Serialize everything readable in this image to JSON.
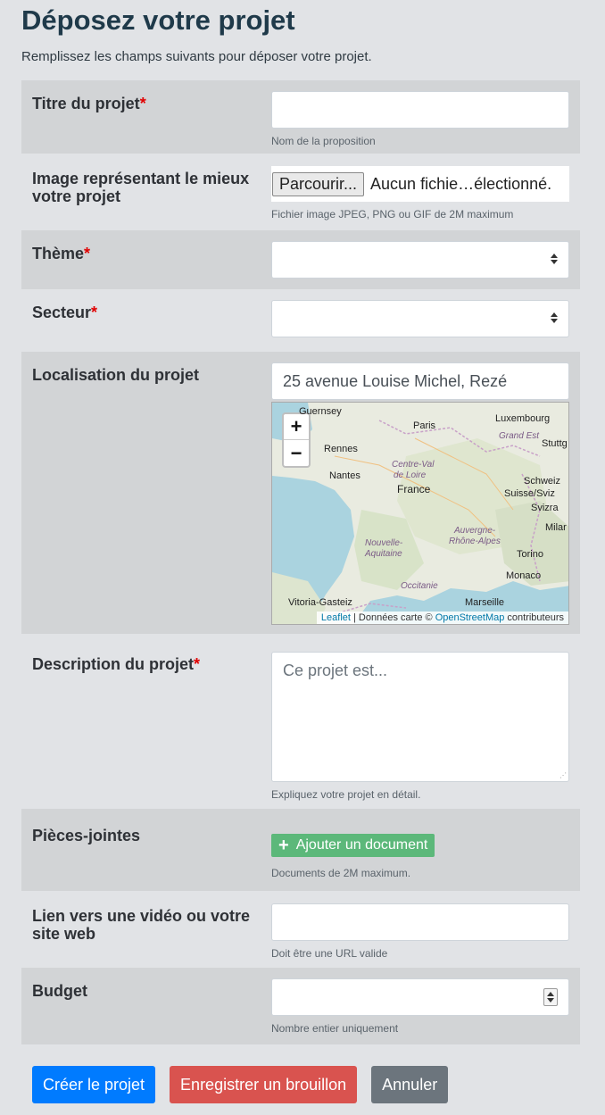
{
  "page": {
    "title": "Déposez votre projet",
    "intro": "Remplissez les champs suivants pour déposer votre projet."
  },
  "fields": {
    "titre": {
      "label": "Titre du projet",
      "required": "*",
      "value": "",
      "help": "Nom de la proposition"
    },
    "image": {
      "label": "Image représentant le mieux votre projet",
      "button": "Parcourir...",
      "status": "Aucun fichie…électionné.",
      "help": "Fichier image JPEG, PNG ou GIF de 2M maximum"
    },
    "theme": {
      "label": "Thème",
      "required": "*",
      "value": ""
    },
    "secteur": {
      "label": "Secteur",
      "required": "*",
      "value": ""
    },
    "localisation": {
      "label": "Localisation du projet",
      "value": "25 avenue Louise Michel, Rezé"
    },
    "description": {
      "label": "Description du projet",
      "required": "*",
      "placeholder": "Ce projet est...",
      "help": "Expliquez votre projet en détail."
    },
    "pieces": {
      "label": "Pièces-jointes",
      "button": "Ajouter un document",
      "help": "Documents de 2M maximum."
    },
    "lien": {
      "label": "Lien vers une vidéo ou votre site web",
      "value": "",
      "help": "Doit être une URL valide"
    },
    "budget": {
      "label": "Budget",
      "value": "",
      "help": "Nombre entier uniquement"
    }
  },
  "map": {
    "zoom_in": "+",
    "zoom_out": "−",
    "labels": {
      "guernsey": "Guernsey",
      "paris": "Paris",
      "luxembourg": "Luxembourg",
      "grand_est": "Grand Est",
      "stuttgart": "Stuttg",
      "rennes": "Rennes",
      "centre": "Centre-Val",
      "de_loire": "de Loire",
      "nantes": "Nantes",
      "france": "France",
      "schweiz": "Schweiz",
      "suisse": "Suisse/Sviz",
      "svizra": "Svizra",
      "auvergne": "Auvergne-",
      "rhone": "Rhône-Alpes",
      "nouvelle": "Nouvelle-",
      "aquitaine": "Aquitaine",
      "milan": "Milar",
      "torino": "Torino",
      "monaco": "Monaco",
      "occitanie": "Occitanie",
      "vitoria": "Vitoria-Gasteiz",
      "marseille": "Marseille"
    },
    "attribution_leaflet": "Leaflet",
    "attribution_sep": " | Données carte © ",
    "attribution_osm": "OpenStreetMap",
    "attribution_tail": " contributeurs"
  },
  "actions": {
    "create": "Créer le projet",
    "draft": "Enregistrer un brouillon",
    "cancel": "Annuler"
  },
  "colors": {
    "primary": "#007bff",
    "danger": "#d9534f",
    "secondary": "#6c757d",
    "success": "#5cb87a"
  }
}
